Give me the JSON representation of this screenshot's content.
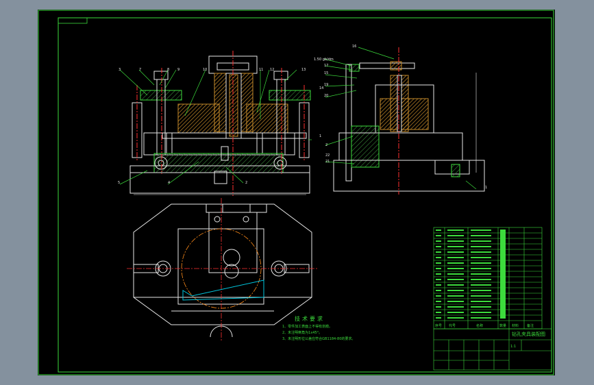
{
  "colors": {
    "background_window": "#84919e",
    "canvas": "#000000",
    "frame": "#3cdc3c",
    "outline": "#e8e8e8",
    "centerline": "#ff3030",
    "leader": "#3cdc3c",
    "hatch": "#c48a2a",
    "sectionline": "#00c8e0",
    "table_text": "#3cdc3c"
  },
  "drawing": {
    "tolerance_note": "1.50 gb/dm",
    "part_numbers_front": [
      "3",
      "7",
      "8",
      "9",
      "10",
      "11",
      "12",
      "13",
      "1",
      "4",
      "2",
      "5"
    ],
    "part_numbers_side": [
      "16",
      "17",
      "15",
      "14",
      "19",
      "20",
      "2",
      "21",
      "22",
      "1"
    ]
  },
  "tech_requirements": {
    "title": "技术要求",
    "lines": [
      "1、零件加工表面上不得有划痕。",
      "2、未注明倒角为1x45°。",
      "3、未注明形位公差应符合GB1184-80的要求。"
    ]
  },
  "title_block": {
    "headers": [
      "序号",
      "代号",
      "名称",
      "数量",
      "材料",
      "备注"
    ],
    "drawing_name": "钻孔夹具装配图",
    "scale": "1:1"
  }
}
